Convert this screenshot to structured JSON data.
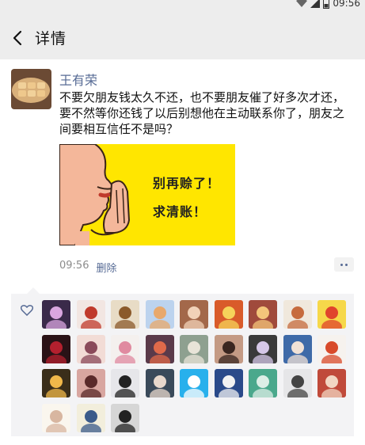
{
  "status": {
    "time": "09:56"
  },
  "header": {
    "title": "详情"
  },
  "post": {
    "author": "王有荣",
    "text": "不要欠朋友钱太久不还，也不要朋友催了好多次才还，要不然等你还钱了以后别想他在主动联系你了，朋友之间要相互信任不是吗？",
    "poster_line1": "别再赊了！",
    "poster_line2": "求清账！",
    "time": "09:56",
    "delete_label": "删除"
  },
  "likes": {
    "avatars": [
      {
        "name": "avatar-galaxy-icon",
        "bg": "#3a2a4a",
        "fg": "#d9a6e0"
      },
      {
        "name": "avatar-anime-girl-icon",
        "bg": "#f2e6e2",
        "fg": "#c0392b"
      },
      {
        "name": "avatar-deer-icon",
        "bg": "#e8dcc6",
        "fg": "#8b5a2b"
      },
      {
        "name": "avatar-cat-icon",
        "bg": "#bcd3ee",
        "fg": "#e8a86b"
      },
      {
        "name": "avatar-person-icon",
        "bg": "#a3684a",
        "fg": "#f1d2b8"
      },
      {
        "name": "avatar-dog-icon",
        "bg": "#d95b2a",
        "fg": "#f6d35a"
      },
      {
        "name": "avatar-landscape-icon",
        "bg": "#a04a3c",
        "fg": "#f4c57a"
      },
      {
        "name": "avatar-robot-icon",
        "bg": "#f0e8dc",
        "fg": "#c66b3d"
      },
      {
        "name": "avatar-pikachu-icon",
        "bg": "#f6d84a",
        "fg": "#e0442c"
      },
      {
        "name": "avatar-dark-girl-icon",
        "bg": "#2a1216",
        "fg": "#b4202e"
      },
      {
        "name": "avatar-anime-boy-icon",
        "bg": "#f2dcd6",
        "fg": "#8a4a5a"
      },
      {
        "name": "avatar-pink-hair-icon",
        "bg": "#f4f0ee",
        "fg": "#e08aa0"
      },
      {
        "name": "avatar-sunset-icon",
        "bg": "#5a3a4a",
        "fg": "#e06a4a"
      },
      {
        "name": "avatar-mountain-icon",
        "bg": "#8ea090",
        "fg": "#e8e4d8"
      },
      {
        "name": "avatar-woman-icon",
        "bg": "#c49a84",
        "fg": "#3a2620"
      },
      {
        "name": "avatar-eye-mask-icon",
        "bg": "#3a3a3a",
        "fg": "#d6c8e8"
      },
      {
        "name": "avatar-blue-hair-icon",
        "bg": "#3e6aa8",
        "fg": "#f1e2d6"
      },
      {
        "name": "avatar-fox-icon",
        "bg": "#f6f2ee",
        "fg": "#d84a2a"
      },
      {
        "name": "avatar-night-sky-icon",
        "bg": "#3a2e1a",
        "fg": "#f0b84a"
      },
      {
        "name": "avatar-girl-portrait-icon",
        "bg": "#d8a6a0",
        "fg": "#5a2a2a"
      },
      {
        "name": "avatar-man-glasses-icon",
        "bg": "#e6e6ea",
        "fg": "#222222"
      },
      {
        "name": "avatar-dark-hair-icon",
        "bg": "#3a4a5a",
        "fg": "#e8d8cc"
      },
      {
        "name": "avatar-rabbit-icon",
        "bg": "#28b0ec",
        "fg": "#ffffff"
      },
      {
        "name": "avatar-penguin-icon",
        "bg": "#2a4a8a",
        "fg": "#f2f2f2"
      },
      {
        "name": "avatar-building-icon",
        "bg": "#4aa88c",
        "fg": "#dceee6"
      },
      {
        "name": "avatar-hat-icon",
        "bg": "#e6e6e8",
        "fg": "#444444"
      },
      {
        "name": "avatar-red-girl-icon",
        "bg": "#c04a3a",
        "fg": "#f2d6c2"
      },
      {
        "name": "avatar-bunny-sketch-icon",
        "bg": "#faf6ee",
        "fg": "#d8b6a0"
      },
      {
        "name": "avatar-cartoon-man-icon",
        "bg": "#f2eedc",
        "fg": "#3a5a8a"
      },
      {
        "name": "avatar-old-man-icon",
        "bg": "#d6d6d6",
        "fg": "#222222"
      }
    ]
  }
}
